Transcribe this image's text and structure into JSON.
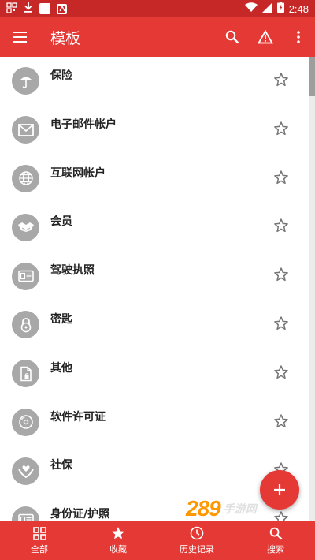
{
  "status_bar": {
    "time": "2:48"
  },
  "app_bar": {
    "title": "模板",
    "actions": [
      "search-icon",
      "warning-icon",
      "overflow-menu-icon"
    ]
  },
  "items": [
    {
      "label": "保险",
      "icon": "umbrella-icon"
    },
    {
      "label": "电子邮件帐户",
      "icon": "email-icon"
    },
    {
      "label": "互联网帐户",
      "icon": "globe-icon"
    },
    {
      "label": "会员",
      "icon": "handshake-icon"
    },
    {
      "label": "驾驶执照",
      "icon": "id-card-icon"
    },
    {
      "label": "密匙",
      "icon": "lock-icon"
    },
    {
      "label": "其他",
      "icon": "document-icon"
    },
    {
      "label": "软件许可证",
      "icon": "disc-icon"
    },
    {
      "label": "社保",
      "icon": "hands-icon"
    },
    {
      "label": "身份证/护照",
      "icon": "id-card-icon"
    }
  ],
  "fab": {
    "icon": "plus-icon"
  },
  "watermark": {
    "number": "289",
    "text": "手游网"
  },
  "bottom_nav": [
    {
      "label": "全部",
      "icon": "grid-icon"
    },
    {
      "label": "收藏",
      "icon": "star-filled-icon"
    },
    {
      "label": "历史记录",
      "icon": "clock-icon"
    },
    {
      "label": "搜索",
      "icon": "search-icon"
    }
  ],
  "colors": {
    "primary": "#e53935",
    "status_bar": "#c62828",
    "icon_circle": "#a8a8a8"
  }
}
